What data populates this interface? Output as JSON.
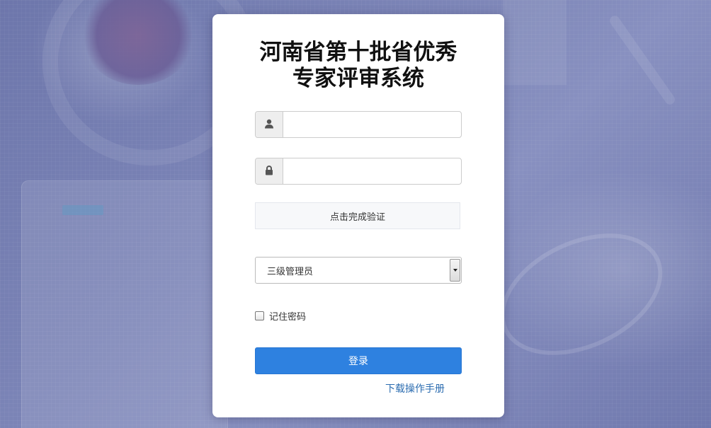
{
  "app": {
    "title_line1": "河南省第十批省优秀",
    "title_line2": "专家评审系统"
  },
  "form": {
    "username": {
      "icon": "user-icon",
      "value": "",
      "placeholder": ""
    },
    "password": {
      "icon": "lock-icon",
      "value": "",
      "placeholder": ""
    },
    "verify_label": "点击完成验证",
    "role_select": {
      "selected": "三级管理员"
    },
    "remember_label": "记住密码",
    "remember_checked": false,
    "login_label": "登录",
    "manual_link": "下载操作手册"
  },
  "colors": {
    "background": "#7079ad",
    "primary_button": "#2e81e0",
    "link": "#2b6cb0"
  }
}
